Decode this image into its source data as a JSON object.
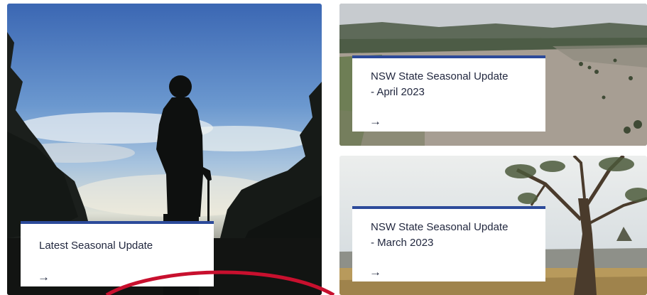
{
  "tiles": [
    {
      "title": "Latest Seasonal Update",
      "arrow": "→"
    },
    {
      "title": "NSW State Seasonal Update - April 2023",
      "arrow": "→"
    },
    {
      "title": "NSW State Seasonal Update - March 2023",
      "arrow": "→"
    }
  ],
  "colors": {
    "card_accent": "#2c4a9a",
    "annotation_circle": "#c8102e"
  },
  "icons": [
    "arrow-right-icon"
  ]
}
